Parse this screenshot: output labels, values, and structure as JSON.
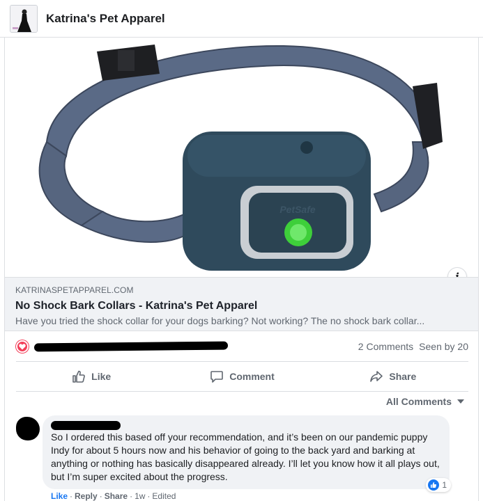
{
  "header": {
    "page_name": "Katrina's Pet Apparel"
  },
  "link_preview": {
    "domain": "KATRINASPETAPPAREL.COM",
    "title": "No Shock Bark Collars - Katrina's Pet Apparel",
    "description": "Have you tried the shock collar for your dogs barking? Not working? The no shock bark collar..."
  },
  "product_image": {
    "brand_text": "PetSafe",
    "collar_color": "#5a6a86",
    "device_color": "#2f4a5c",
    "led_color": "#3ecf3a"
  },
  "reactions": {
    "comments": "2 Comments",
    "seen_by": "Seen by 20"
  },
  "actions": {
    "like": "Like",
    "comment": "Comment",
    "share": "Share"
  },
  "comments_filter": {
    "label": "All Comments"
  },
  "comment": {
    "text": "So I ordered this based off your recommendation, and it’s been on our pandemic puppy Indy for about 5 hours now and his behavior of going to the back yard and barking at anything or nothing has basically disappeared already. I’ll let you know how it all plays out, but I’m super excited about the progress.",
    "reaction_count": "1",
    "like": "Like",
    "reply": "Reply",
    "share": "Share",
    "time": "1w",
    "edited": "Edited",
    "separator": "·"
  },
  "colors": {
    "accent": "#1877f2",
    "heart": "#f33e58",
    "muted": "#606770"
  }
}
